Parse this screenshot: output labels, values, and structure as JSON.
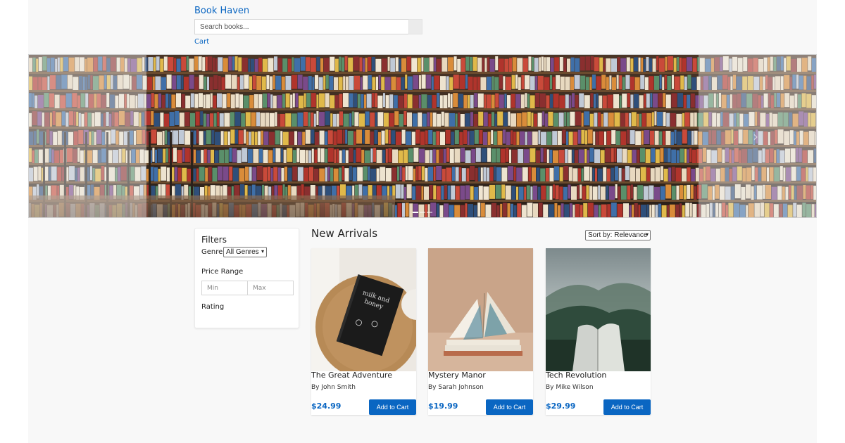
{
  "header": {
    "brand": "Book Haven",
    "search_placeholder": "Search books...",
    "cart_label": "Cart"
  },
  "hero": {
    "slide_count": 3,
    "active_slide": 1
  },
  "filters": {
    "title": "Filters",
    "genre_label": "Genre",
    "genre_selected": "All Genres",
    "price_label": "Price Range",
    "price_min_placeholder": "Min",
    "price_max_placeholder": "Max",
    "rating_label": "Rating"
  },
  "main": {
    "title": "New Arrivals",
    "sort_selected": "Sort by: Relevance",
    "books": [
      {
        "title": "The Great Adventure",
        "author": "By John Smith",
        "price": "$24.99",
        "button": "Add to Cart"
      },
      {
        "title": "Mystery Manor",
        "author": "By Sarah Johnson",
        "price": "$19.99",
        "button": "Add to Cart"
      },
      {
        "title": "Tech Revolution",
        "author": "By Mike Wilson",
        "price": "$29.99",
        "button": "Add to Cart"
      }
    ]
  },
  "colors": {
    "accent": "#0a66c2",
    "page_bg": "#f8f8f8"
  }
}
